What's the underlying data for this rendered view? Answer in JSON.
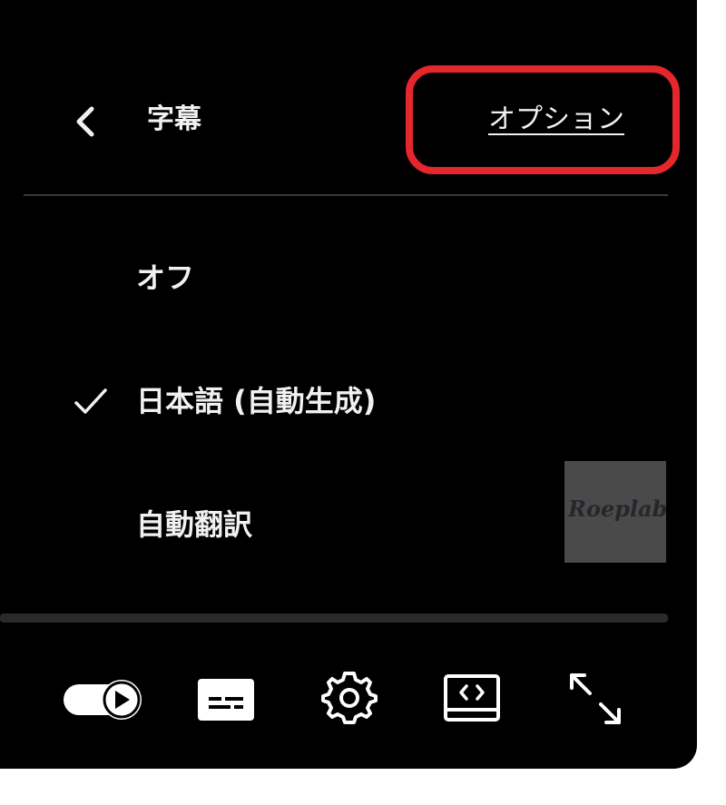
{
  "header": {
    "title": "字幕",
    "options_label": "オプション"
  },
  "menu": {
    "items": [
      {
        "label": "オフ",
        "selected": false
      },
      {
        "label": "日本語 (自動生成)",
        "selected": true
      },
      {
        "label": "自動翻訳",
        "selected": false
      }
    ]
  },
  "thumbnail": {
    "logo_text": "Roeplab"
  },
  "controls": {
    "autoplay_on": true,
    "icons": [
      "autoplay-toggle-icon",
      "subtitles-icon",
      "settings-gear-icon",
      "theater-mode-icon",
      "fullscreen-icon"
    ]
  },
  "colors": {
    "background": "#000000",
    "text": "#f1f1f1",
    "highlight": "#e4262d",
    "divider": "#3a3a3a"
  }
}
